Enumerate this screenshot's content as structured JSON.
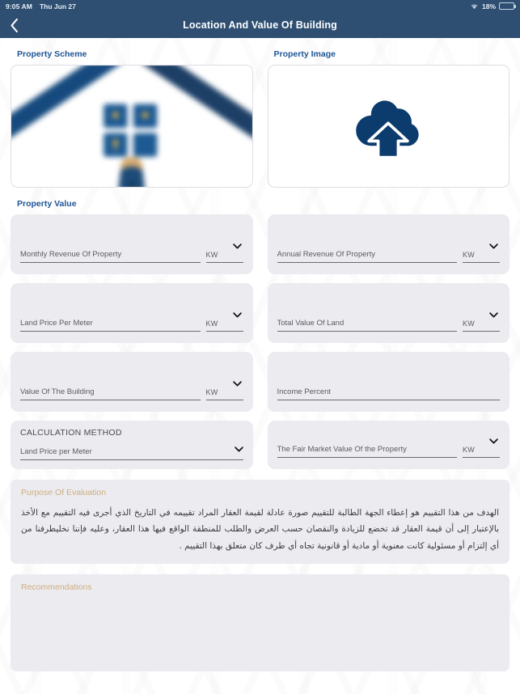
{
  "statusbar": {
    "time": "9:05 AM",
    "date": "Thu Jun 27",
    "battery_percent": "18%",
    "wifi_icon": "wifi-icon",
    "battery_icon": "battery-icon"
  },
  "header": {
    "title": "Location And Value Of Building",
    "back_icon": "chevron-left-icon"
  },
  "sections": {
    "property_scheme_label": "Property Scheme",
    "property_image_label": "Property Image",
    "property_value_label": "Property Value"
  },
  "media": {
    "scheme_icon": "house-illustration",
    "upload_icon": "cloud-upload-icon"
  },
  "fields": {
    "monthly_revenue": {
      "label": "Monthly Revenue Of Property",
      "unit": "KW",
      "value": ""
    },
    "annual_revenue": {
      "label": "Annual Revenue Of Property",
      "unit": "KW",
      "value": ""
    },
    "land_price_per_meter": {
      "label": "Land Price Per Meter",
      "unit": "KW",
      "value": ""
    },
    "total_value_of_land": {
      "label": "Total Value Of Land",
      "unit": "KW",
      "value": ""
    },
    "value_of_building": {
      "label": "Value Of The Building",
      "unit": "KW",
      "value": ""
    },
    "income_percent": {
      "label": "Income Percent",
      "value": ""
    },
    "calculation_method": {
      "title": "CALCULATION METHOD",
      "value": "Land Price per Meter"
    },
    "fair_market_value": {
      "label": "The Fair Market Value Of the Property",
      "unit": "KW",
      "value": ""
    }
  },
  "purpose": {
    "title": "Purpose Of Evaluation",
    "text": "الهدف من هذا التقييم هو إعطاء الجهة الطالبة للتقييم صورة عادلة لقيمة العقار المراد تقييمه في التاريخ الذي أجرى فيه التقييم مع الأخذ بالإعتبار إلى أن قيمة العقار قد تخضع للزيادة والنقصان حسب العرض والطلب للمنطقة الواقع فيها هذا العقار، وعليه فإننا نخليطرفنا من أي إلتزام أو مسئولية كانت معنوية أو مادية أو قانونية تجاه أي طرف كان متعلق بهذا التقييم ."
  },
  "recommendations": {
    "title": "Recommendations",
    "text": ""
  },
  "colors": {
    "header_bg": "#2e4f72",
    "accent_blue": "#1d5596",
    "icon_navy": "#0c3c6e",
    "field_bg": "#ebebf0",
    "tan_label": "#cfae80"
  }
}
